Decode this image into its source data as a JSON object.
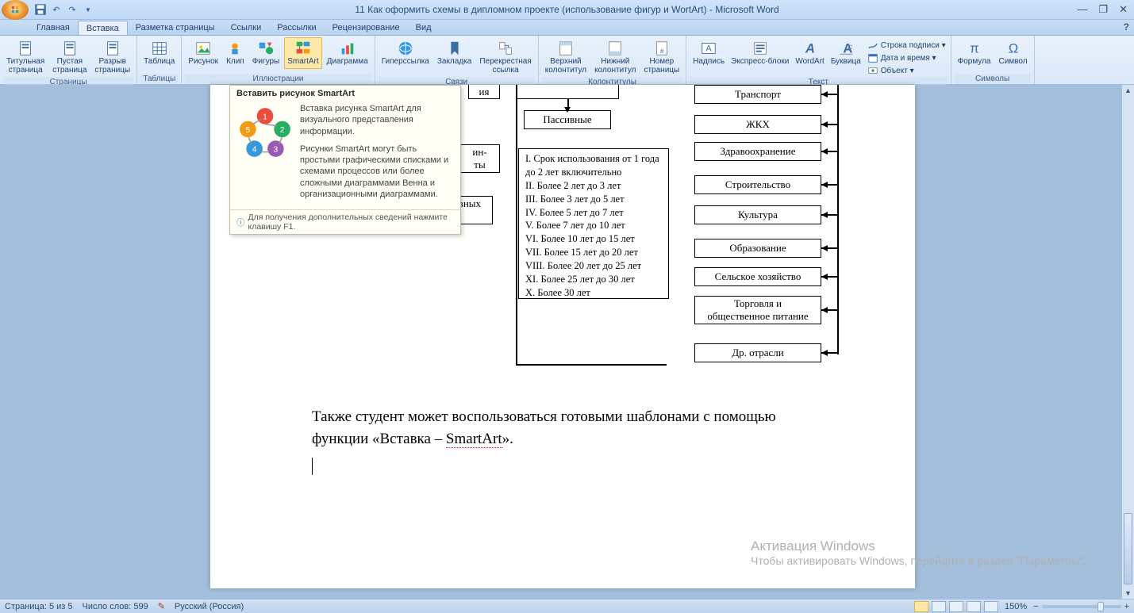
{
  "title": "11 Как оформить схемы в дипломном проекте (использование фигур и WortArt) - Microsoft Word",
  "tabs": [
    "Главная",
    "Вставка",
    "Разметка страницы",
    "Ссылки",
    "Рассылки",
    "Рецензирование",
    "Вид"
  ],
  "activeTab": 1,
  "groups": {
    "pages": {
      "label": "Страницы",
      "btns": [
        "Титульная\nстраница",
        "Пустая\nстраница",
        "Разрыв\nстраницы"
      ]
    },
    "tables": {
      "label": "Таблицы",
      "btns": [
        "Таблица"
      ]
    },
    "illus": {
      "label": "Иллюстрации",
      "btns": [
        "Рисунок",
        "Клип",
        "Фигуры",
        "SmartArt",
        "Диаграмма"
      ]
    },
    "links": {
      "label": "Связи",
      "btns": [
        "Гиперссылка",
        "Закладка",
        "Перекрестная\nссылка"
      ]
    },
    "headers": {
      "label": "Колонтитулы",
      "btns": [
        "Верхний\nколонтитул",
        "Нижний\nколонтитул",
        "Номер\nстраницы"
      ]
    },
    "text": {
      "label": "Текст",
      "btns": [
        "Надпись",
        "Экспресс-блоки",
        "WordArt",
        "Буквица"
      ],
      "mini": [
        "Строка подписи",
        "Дата и время",
        "Объект"
      ]
    },
    "symbols": {
      "label": "Символы",
      "btns": [
        "Формула",
        "Символ"
      ]
    }
  },
  "tooltip": {
    "title": "Вставить рисунок SmartArt",
    "p1": "Вставка рисунка SmartArt для визуального представления информации.",
    "p2": "Рисунки SmartArt могут быть простыми графическими списками и схемами процессов или более сложными диаграммами Венна и организационными диаграммами.",
    "footer": "Для получения дополнительных сведений нажмите клавишу F1."
  },
  "diagram": {
    "left_partial_top": "ия",
    "left_partial_mid": "ин-\nты",
    "left_box": "Прочие объекты основных\nсредств",
    "center": "Пассивные",
    "list": [
      "I. Срок использования от 1 года до 2 лет включительно",
      "II. Более 2 лет до 3 лет",
      "III. Более 3 лет до 5 лет",
      "IV. Более 5 лет до 7 лет",
      "V. Более 7 лет до 10 лет",
      "VI. Более 10 лет до 15 лет",
      "VII. Более 15 лет до 20 лет",
      "VIII. Более 20 лет до 25 лет",
      "XI. Более 25 лет до 30 лет",
      "X. Более 30 лет"
    ],
    "right": [
      "Транспорт",
      "ЖКХ",
      "Здравоохранение",
      "Строительство",
      "Культура",
      "Образование",
      "Сельское хозяйство",
      "Торговля и\nобщественное питание",
      "Др. отрасли"
    ]
  },
  "paragraph": "Также студент может воспользоваться готовыми шаблонами с помощью функции «Вставка – ",
  "paragraph_wavy": "SmartArt",
  "paragraph_end": "».",
  "status": {
    "page": "Страница: 5 из 5",
    "words": "Число слов: 599",
    "lang": "Русский (Россия)",
    "zoom": "150%"
  },
  "watermark": {
    "l1": "Активация Windows",
    "l2": "Чтобы активировать Windows, перейдите в раздел \"Параметры\"."
  }
}
